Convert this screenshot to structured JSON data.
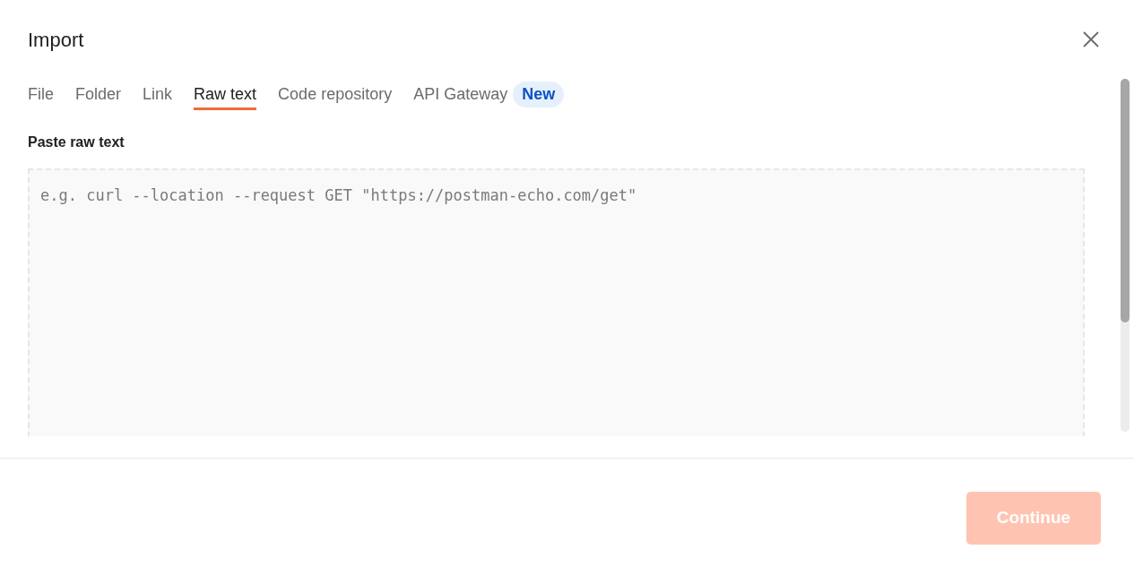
{
  "dialog": {
    "title": "Import"
  },
  "tabs": [
    {
      "label": "File",
      "selected": false
    },
    {
      "label": "Folder",
      "selected": false
    },
    {
      "label": "Link",
      "selected": false
    },
    {
      "label": "Raw text",
      "selected": true
    },
    {
      "label": "Code repository",
      "selected": false
    },
    {
      "label": "API Gateway",
      "selected": false,
      "badge": "New"
    }
  ],
  "raw_text": {
    "label": "Paste raw text",
    "placeholder": "e.g. curl --location --request GET \"https://postman-echo.com/get\""
  },
  "continue_button": {
    "label": "Continue",
    "disabled": true
  }
}
